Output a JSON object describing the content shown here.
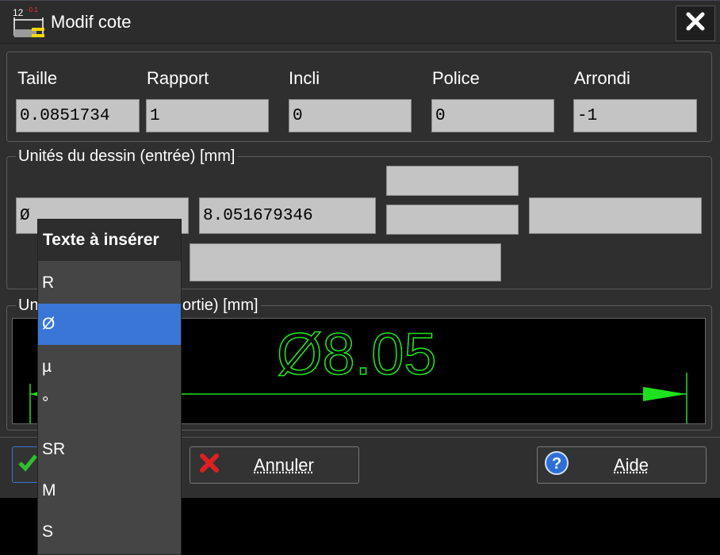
{
  "window": {
    "title": "Modif cote",
    "icon": "dimension-icon"
  },
  "params": [
    {
      "label": "Taille",
      "value": "0.0851734"
    },
    {
      "label": "Rapport",
      "value": "1"
    },
    {
      "label": "Incli",
      "value": "0"
    },
    {
      "label": "Police",
      "value": "0"
    },
    {
      "label": "Arrondi",
      "value": "-1"
    }
  ],
  "input_group": {
    "legend": "Unités du dessin (entrée) [mm]",
    "prefix": "Ø",
    "value": "8.051679346",
    "tol_upper": "",
    "tol_lower": "",
    "suffix": "",
    "text_below": ""
  },
  "output_group": {
    "legend_start": "Un",
    "legend_end": "ortie) [mm]",
    "preview_text": "Ø8.05"
  },
  "buttons": {
    "ok": "",
    "cancel": "Annuler",
    "help": "Aide"
  },
  "popup": {
    "title": "Texte à insérer",
    "items": [
      "R",
      "Ø",
      "µ",
      "°",
      "SR",
      "M",
      "S"
    ],
    "selected_index": 1
  },
  "colors": {
    "accent": "#3a76d6",
    "preview_green": "#1fe01f",
    "field_bg": "#c4c4c4"
  }
}
